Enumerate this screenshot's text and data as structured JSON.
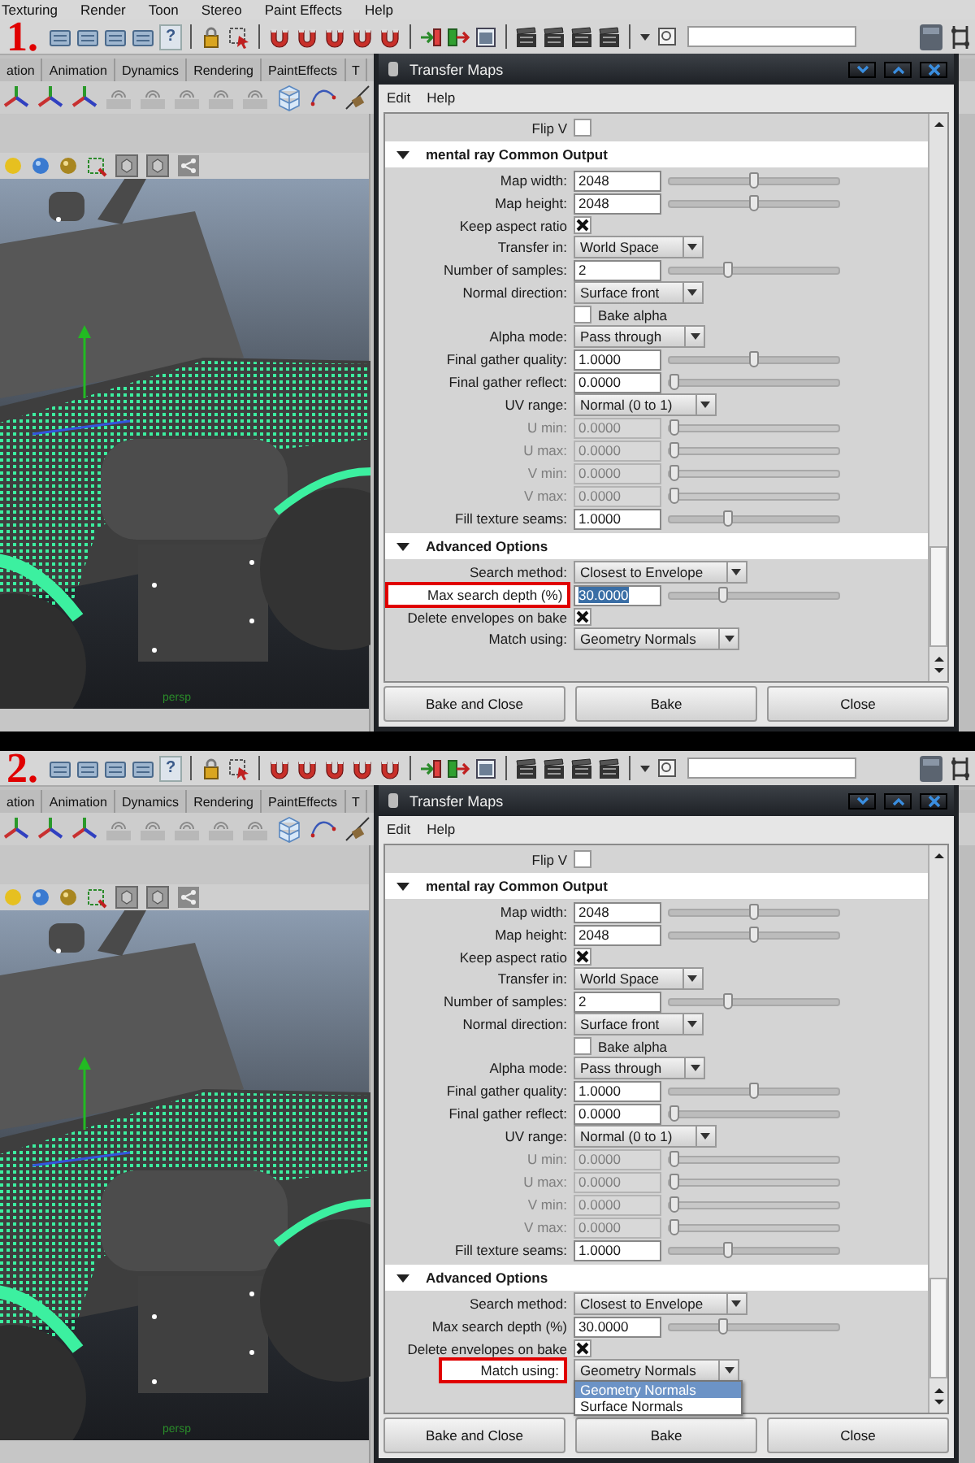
{
  "panels": [
    {
      "step_label": "1.",
      "menu": [
        "Texturing",
        "Render",
        "Toon",
        "Stereo",
        "Paint Effects",
        "Help"
      ],
      "help_button": "?",
      "shelf_tabs": [
        "ation",
        "Animation",
        "Dynamics",
        "Rendering",
        "PaintEffects",
        "T"
      ],
      "viewport_label": "persp",
      "dialog": {
        "title": "Transfer Maps",
        "menu": [
          "Edit",
          "Help"
        ],
        "rows": [
          {
            "kind": "checkbox",
            "label": "Flip V",
            "checked": false,
            "highlighted": false
          },
          {
            "kind": "header",
            "label": "mental ray Common Output"
          },
          {
            "kind": "slider",
            "label": "Map width:",
            "value": "2048",
            "level": 0.5,
            "disabled": false,
            "value_selected": false,
            "highlighted": false
          },
          {
            "kind": "slider",
            "label": "Map height:",
            "value": "2048",
            "level": 0.5,
            "disabled": false,
            "value_selected": false,
            "highlighted": false
          },
          {
            "kind": "checkbox",
            "label": "Keep aspect ratio",
            "checked": true,
            "highlighted": false
          },
          {
            "kind": "dropdown",
            "label": "Transfer in:",
            "value": "World Space",
            "open": false,
            "highlighted": false
          },
          {
            "kind": "slider",
            "label": "Number of samples:",
            "value": "2",
            "level": 0.34,
            "disabled": false,
            "value_selected": false,
            "highlighted": false
          },
          {
            "kind": "dropdown",
            "label": "Normal direction:",
            "value": "Surface front",
            "open": false,
            "highlighted": false
          },
          {
            "kind": "checkbox_after",
            "label": "Bake alpha",
            "checked": false,
            "highlighted": false
          },
          {
            "kind": "dropdown",
            "label": "Alpha mode:",
            "value": "Pass through",
            "open": false,
            "highlighted": false
          },
          {
            "kind": "slider",
            "label": "Final gather quality:",
            "value": "1.0000",
            "level": 0.5,
            "disabled": false,
            "value_selected": false,
            "highlighted": false
          },
          {
            "kind": "slider",
            "label": "Final gather reflect:",
            "value": "0.0000",
            "level": 0,
            "disabled": false,
            "value_selected": false,
            "highlighted": false
          },
          {
            "kind": "dropdown",
            "label": "UV range:",
            "value": "Normal (0 to 1)",
            "open": false,
            "highlighted": false
          },
          {
            "kind": "slider",
            "label": "U min:",
            "value": "0.0000",
            "level": 0,
            "disabled": true,
            "value_selected": false,
            "highlighted": false
          },
          {
            "kind": "slider",
            "label": "U max:",
            "value": "0.0000",
            "level": 0,
            "disabled": true,
            "value_selected": false,
            "highlighted": false
          },
          {
            "kind": "slider",
            "label": "V min:",
            "value": "0.0000",
            "level": 0,
            "disabled": true,
            "value_selected": false,
            "highlighted": false
          },
          {
            "kind": "slider",
            "label": "V max:",
            "value": "0.0000",
            "level": 0,
            "disabled": true,
            "value_selected": false,
            "highlighted": false
          },
          {
            "kind": "slider",
            "label": "Fill texture seams:",
            "value": "1.0000",
            "level": 0.34,
            "disabled": false,
            "value_selected": false,
            "highlighted": false
          },
          {
            "kind": "header",
            "label": "Advanced Options"
          },
          {
            "kind": "dropdown",
            "label": "Search method:",
            "value": "Closest to Envelope",
            "open": false,
            "highlighted": false
          },
          {
            "kind": "slider",
            "label": "Max search depth (%)",
            "value": "30.0000",
            "level": 0.31,
            "disabled": false,
            "value_selected": true,
            "highlighted": true
          },
          {
            "kind": "checkbox",
            "label": "Delete envelopes on bake",
            "checked": true,
            "highlighted": false
          },
          {
            "kind": "dropdown",
            "label": "Match using:",
            "value": "Geometry Normals",
            "open": false,
            "highlighted": false
          }
        ],
        "buttons": [
          "Bake and Close",
          "Bake",
          "Close"
        ]
      }
    },
    {
      "step_label": "2.",
      "help_button": "?",
      "shelf_tabs": [
        "ation",
        "Animation",
        "Dynamics",
        "Rendering",
        "PaintEffects",
        "T"
      ],
      "viewport_label": "persp",
      "dialog": {
        "title": "Transfer Maps",
        "menu": [
          "Edit",
          "Help"
        ],
        "rows": [
          {
            "kind": "checkbox",
            "label": "Flip V",
            "checked": false,
            "highlighted": false
          },
          {
            "kind": "header",
            "label": "mental ray Common Output"
          },
          {
            "kind": "slider",
            "label": "Map width:",
            "value": "2048",
            "level": 0.5,
            "disabled": false,
            "value_selected": false,
            "highlighted": false
          },
          {
            "kind": "slider",
            "label": "Map height:",
            "value": "2048",
            "level": 0.5,
            "disabled": false,
            "value_selected": false,
            "highlighted": false
          },
          {
            "kind": "checkbox",
            "label": "Keep aspect ratio",
            "checked": true,
            "highlighted": false
          },
          {
            "kind": "dropdown",
            "label": "Transfer in:",
            "value": "World Space",
            "open": false,
            "highlighted": false
          },
          {
            "kind": "slider",
            "label": "Number of samples:",
            "value": "2",
            "level": 0.34,
            "disabled": false,
            "value_selected": false,
            "highlighted": false
          },
          {
            "kind": "dropdown",
            "label": "Normal direction:",
            "value": "Surface front",
            "open": false,
            "highlighted": false
          },
          {
            "kind": "checkbox_after",
            "label": "Bake alpha",
            "checked": false,
            "highlighted": false
          },
          {
            "kind": "dropdown",
            "label": "Alpha mode:",
            "value": "Pass through",
            "open": false,
            "highlighted": false
          },
          {
            "kind": "slider",
            "label": "Final gather quality:",
            "value": "1.0000",
            "level": 0.5,
            "disabled": false,
            "value_selected": false,
            "highlighted": false
          },
          {
            "kind": "slider",
            "label": "Final gather reflect:",
            "value": "0.0000",
            "level": 0,
            "disabled": false,
            "value_selected": false,
            "highlighted": false
          },
          {
            "kind": "dropdown",
            "label": "UV range:",
            "value": "Normal (0 to 1)",
            "open": false,
            "highlighted": false
          },
          {
            "kind": "slider",
            "label": "U min:",
            "value": "0.0000",
            "level": 0,
            "disabled": true,
            "value_selected": false,
            "highlighted": false
          },
          {
            "kind": "slider",
            "label": "U max:",
            "value": "0.0000",
            "level": 0,
            "disabled": true,
            "value_selected": false,
            "highlighted": false
          },
          {
            "kind": "slider",
            "label": "V min:",
            "value": "0.0000",
            "level": 0,
            "disabled": true,
            "value_selected": false,
            "highlighted": false
          },
          {
            "kind": "slider",
            "label": "V max:",
            "value": "0.0000",
            "level": 0,
            "disabled": true,
            "value_selected": false,
            "highlighted": false
          },
          {
            "kind": "slider",
            "label": "Fill texture seams:",
            "value": "1.0000",
            "level": 0.34,
            "disabled": false,
            "value_selected": false,
            "highlighted": false
          },
          {
            "kind": "header",
            "label": "Advanced Options"
          },
          {
            "kind": "dropdown",
            "label": "Search method:",
            "value": "Closest to Envelope",
            "open": false,
            "highlighted": false
          },
          {
            "kind": "slider",
            "label": "Max search depth (%)",
            "value": "30.0000",
            "level": 0.31,
            "disabled": false,
            "value_selected": false,
            "highlighted": false
          },
          {
            "kind": "checkbox",
            "label": "Delete envelopes on bake",
            "checked": true,
            "highlighted": false
          },
          {
            "kind": "dropdown",
            "label": "Match using:",
            "value": "Geometry Normals",
            "open": true,
            "highlighted": true,
            "options": [
              {
                "label": "Geometry Normals",
                "selected": true
              },
              {
                "label": "Surface Normals",
                "selected": false
              }
            ]
          }
        ],
        "buttons": [
          "Bake and Close",
          "Bake",
          "Close"
        ]
      }
    }
  ]
}
